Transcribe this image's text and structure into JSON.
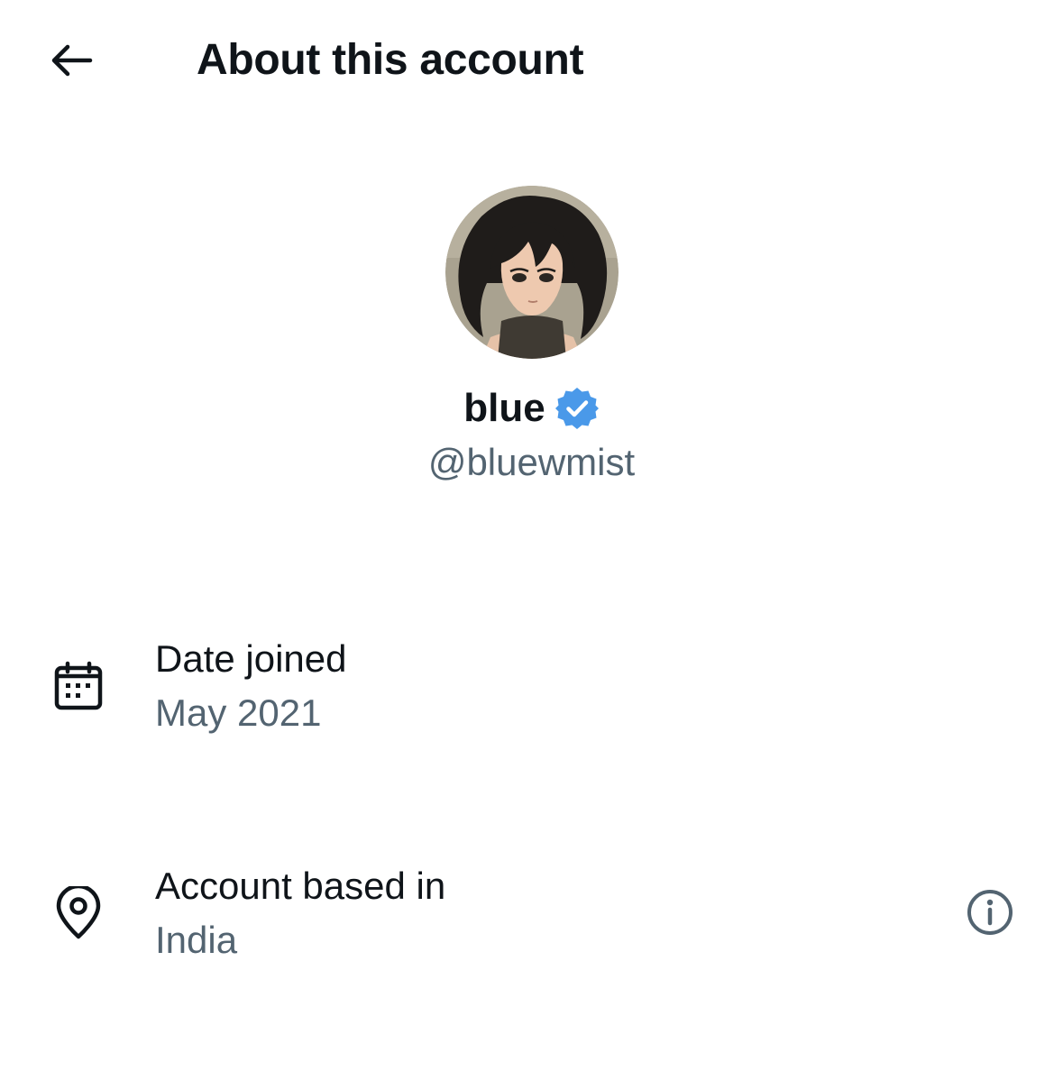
{
  "header": {
    "title": "About this account",
    "back_icon": "arrow-left-icon"
  },
  "profile": {
    "display_name": "blue",
    "handle": "@bluewmist",
    "verified_icon": "verified-badge-icon",
    "verified_color": "#4a99e9"
  },
  "details": {
    "date_joined": {
      "icon": "calendar-icon",
      "label": "Date joined",
      "value": "May 2021"
    },
    "account_based_in": {
      "icon": "location-pin-icon",
      "label": "Account based in",
      "value": "India",
      "info_icon": "info-icon"
    }
  },
  "colors": {
    "primary_text": "#0f1419",
    "secondary_text": "#536471"
  }
}
